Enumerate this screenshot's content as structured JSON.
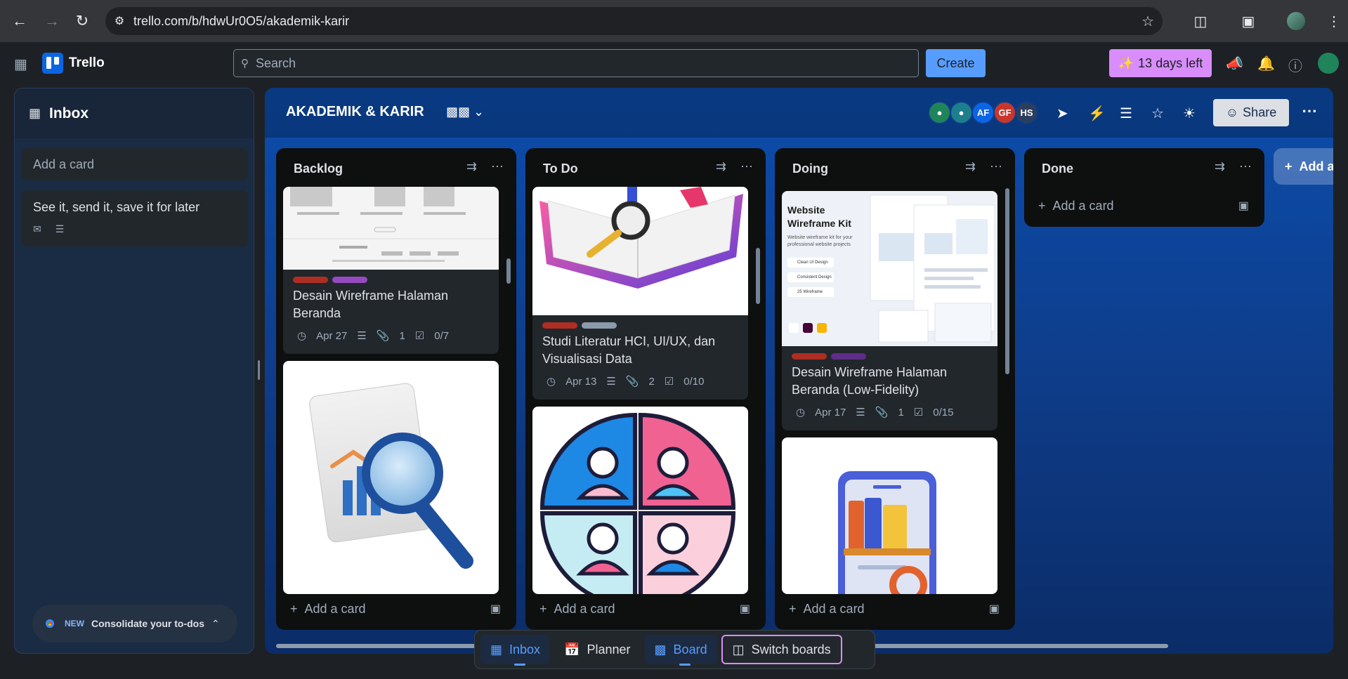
{
  "browser": {
    "url": "trello.com/b/hdwUr0O5/akademik-karir",
    "back_icon": "arrow-left",
    "forward_icon": "arrow-right",
    "reload_icon": "reload"
  },
  "header": {
    "app_name": "Trello",
    "search_placeholder": "Search",
    "create_label": "Create",
    "trial_label": "13 days left"
  },
  "inbox": {
    "title": "Inbox",
    "add_card_placeholder": "Add a card",
    "cards": [
      {
        "title": "See it, send it, save it for later"
      }
    ],
    "promo": {
      "badge": "NEW",
      "text": "Consolidate your to-dos"
    }
  },
  "board": {
    "title": "AKADEMIK & KARIR",
    "members": [
      {
        "initials": "",
        "color": "#1f845a"
      },
      {
        "initials": "",
        "color": "#1d7f8c"
      },
      {
        "initials": "AF",
        "color": "#0c66e4"
      },
      {
        "initials": "GF",
        "color": "#c9372c"
      },
      {
        "initials": "HS",
        "color": "#2c3e5d"
      }
    ],
    "share_label": "Share",
    "lists": [
      {
        "name": "Backlog",
        "add_card_label": "Add a card",
        "cards": [
          {
            "labels": [
              "#ae2e24",
              "#964ac0"
            ],
            "title": "Desain Wireframe Halaman Beranda",
            "due": "Apr 27",
            "attachments": "1",
            "checklist": "0/7"
          }
        ]
      },
      {
        "name": "To Do",
        "add_card_label": "Add a card",
        "cards": [
          {
            "labels": [
              "#ae2e24",
              "#8c9bab"
            ],
            "title": "Studi Literatur HCI, UI/UX, dan Visualisasi Data",
            "due": "Apr 13",
            "attachments": "2",
            "checklist": "0/10"
          }
        ]
      },
      {
        "name": "Doing",
        "add_card_label": "Add a card",
        "cards": [
          {
            "labels": [
              "#ae2e24",
              "#5e2d8a"
            ],
            "title": "Desain Wireframe Halaman Beranda (Low-Fidelity)",
            "due": "Apr 17",
            "attachments": "1",
            "checklist": "0/15",
            "cover": {
              "heading": "Website Wireframe Kit",
              "sub": "Website wireframe kit for your professional website projects",
              "chips": [
                "Clean UI Design",
                "Consistent Design",
                "25 Wireframe"
              ]
            }
          }
        ]
      },
      {
        "name": "Done",
        "add_card_label": "Add a card",
        "cards": []
      }
    ],
    "add_list_label": "Add a"
  },
  "bottom_nav": {
    "inbox": "Inbox",
    "planner": "Planner",
    "board": "Board",
    "switch": "Switch boards"
  }
}
